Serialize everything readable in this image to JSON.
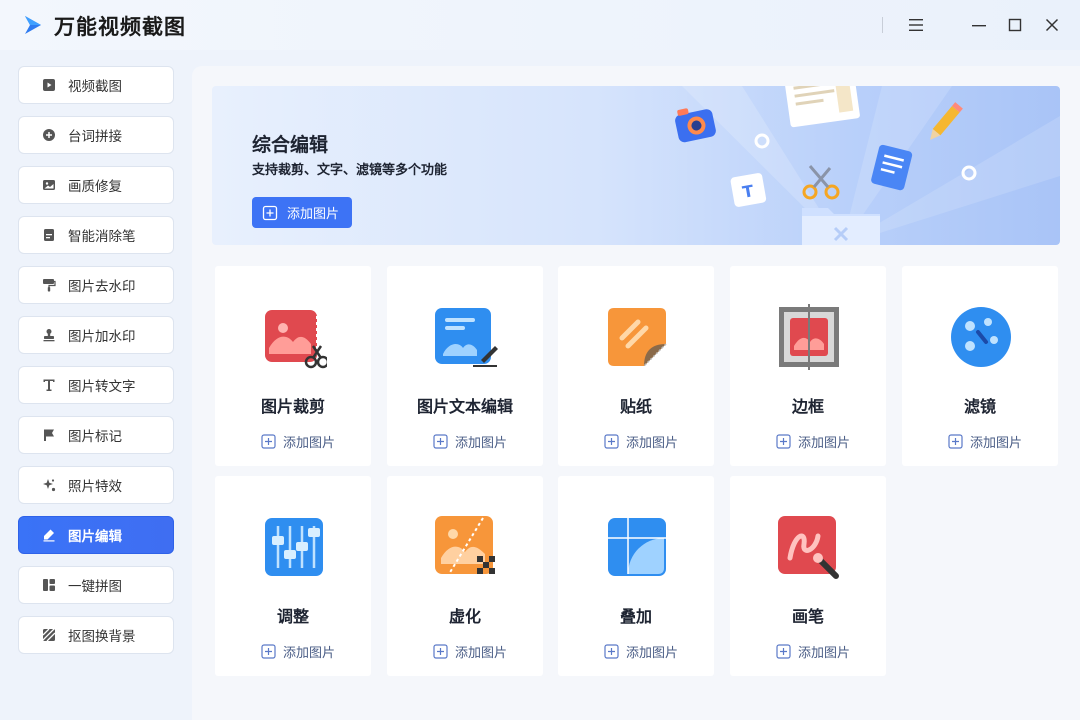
{
  "app": {
    "title": "万能视频截图"
  },
  "sidebar": {
    "items": [
      {
        "label": "视频截图",
        "icon": "play-square-icon"
      },
      {
        "label": "台词拼接",
        "icon": "plus-circle-icon"
      },
      {
        "label": "画质修复",
        "icon": "image-icon"
      },
      {
        "label": "智能消除笔",
        "icon": "document-icon"
      },
      {
        "label": "图片去水印",
        "icon": "paint-roller-icon"
      },
      {
        "label": "图片加水印",
        "icon": "stamp-icon"
      },
      {
        "label": "图片转文字",
        "icon": "text-t-icon"
      },
      {
        "label": "图片标记",
        "icon": "flag-icon"
      },
      {
        "label": "照片特效",
        "icon": "sparkle-icon"
      },
      {
        "label": "图片编辑",
        "icon": "pen-edit-icon",
        "active": true
      },
      {
        "label": "一键拼图",
        "icon": "collage-icon"
      },
      {
        "label": "抠图换背景",
        "icon": "stripes-icon"
      }
    ]
  },
  "banner": {
    "title": "综合编辑",
    "subtitle": "支持裁剪、文字、滤镜等多个功能",
    "button_label": "添加图片"
  },
  "cards": [
    {
      "title": "图片裁剪",
      "add_label": "添加图片",
      "icon": "crop-icon"
    },
    {
      "title": "图片文本编辑",
      "add_label": "添加图片",
      "icon": "text-edit-icon"
    },
    {
      "title": "贴纸",
      "add_label": "添加图片",
      "icon": "sticker-icon"
    },
    {
      "title": "边框",
      "add_label": "添加图片",
      "icon": "border-frame-icon"
    },
    {
      "title": "滤镜",
      "add_label": "添加图片",
      "icon": "filter-icon"
    },
    {
      "title": "调整",
      "add_label": "添加图片",
      "icon": "adjust-sliders-icon"
    },
    {
      "title": "虚化",
      "add_label": "添加图片",
      "icon": "blur-icon"
    },
    {
      "title": "叠加",
      "add_label": "添加图片",
      "icon": "overlay-icon"
    },
    {
      "title": "画笔",
      "add_label": "添加图片",
      "icon": "brush-icon"
    }
  ],
  "colors": {
    "accent": "#3d73f5",
    "active_item": "#3a73f7"
  }
}
